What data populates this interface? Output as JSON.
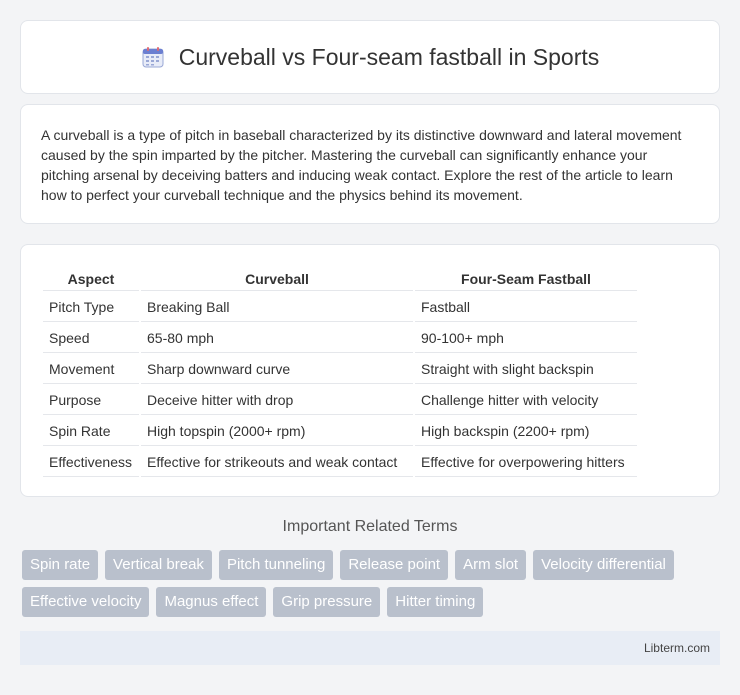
{
  "header": {
    "title": "Curveball vs Four-seam fastball in Sports"
  },
  "intro": {
    "text": "A curveball is a type of pitch in baseball characterized by its distinctive downward and lateral movement caused by the spin imparted by the pitcher. Mastering the curveball can significantly enhance your pitching arsenal by deceiving batters and inducing weak contact. Explore the rest of the article to learn how to perfect your curveball technique and the physics behind its movement."
  },
  "table": {
    "headers": [
      "Aspect",
      "Curveball",
      "Four-Seam Fastball"
    ],
    "rows": [
      [
        "Pitch Type",
        "Breaking Ball",
        "Fastball"
      ],
      [
        "Speed",
        "65-80 mph",
        "90-100+ mph"
      ],
      [
        "Movement",
        "Sharp downward curve",
        "Straight with slight backspin"
      ],
      [
        "Purpose",
        "Deceive hitter with drop",
        "Challenge hitter with velocity"
      ],
      [
        "Spin Rate",
        "High topspin (2000+ rpm)",
        "High backspin (2200+ rpm)"
      ],
      [
        "Effectiveness",
        "Effective for strikeouts and weak contact",
        "Effective for overpowering hitters"
      ]
    ]
  },
  "terms": {
    "title": "Important Related Terms",
    "items": [
      "Spin rate",
      "Vertical break",
      "Pitch tunneling",
      "Release point",
      "Arm slot",
      "Velocity differential",
      "Effective velocity",
      "Magnus effect",
      "Grip pressure",
      "Hitter timing"
    ]
  },
  "footer": {
    "text": "Libterm.com"
  },
  "icons": {
    "title_icon": "calendar-icon"
  },
  "colors": {
    "tag_bg": "#b9c0cc",
    "footer_bg": "#e8edf5",
    "page_bg": "#f3f4f6"
  }
}
